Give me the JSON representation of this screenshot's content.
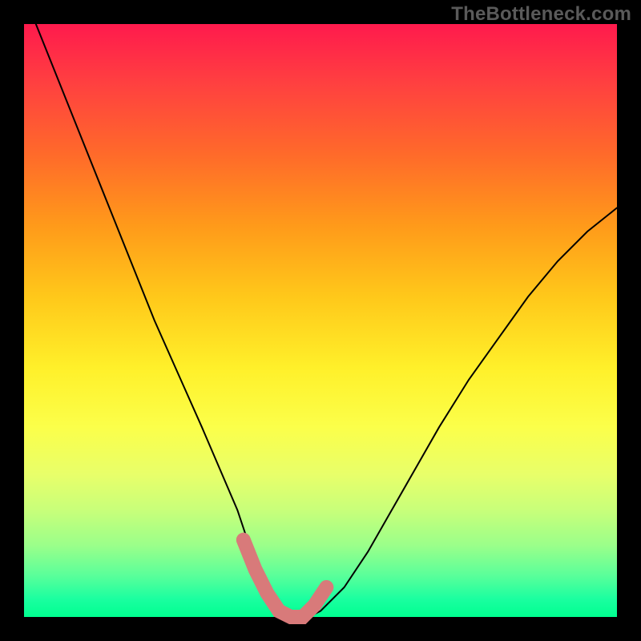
{
  "watermark": "TheBottleneck.com",
  "colors": {
    "curve_stroke": "#000000",
    "highlight_stroke": "#d87a7a",
    "frame_bg": "#000000"
  },
  "chart_data": {
    "type": "line",
    "title": "",
    "xlabel": "",
    "ylabel": "",
    "xlim": [
      0,
      100
    ],
    "ylim": [
      0,
      100
    ],
    "grid": false,
    "legend": false,
    "annotations": [
      "TheBottleneck.com"
    ],
    "description": "Single V-shaped curve on a vertical rainbow (red→green) gradient background with no axes or tick labels. A short pink segment overlays the bottom of the V. Values are estimated from the plot area.",
    "series": [
      {
        "name": "bottleneck-curve",
        "x": [
          2,
          6,
          10,
          14,
          18,
          22,
          26,
          30,
          33,
          36,
          38,
          40,
          42,
          44,
          46,
          48,
          50,
          54,
          58,
          62,
          66,
          70,
          75,
          80,
          85,
          90,
          95,
          100
        ],
        "y": [
          100,
          90,
          80,
          70,
          60,
          50,
          41,
          32,
          25,
          18,
          12,
          7,
          3,
          1,
          0,
          0,
          1,
          5,
          11,
          18,
          25,
          32,
          40,
          47,
          54,
          60,
          65,
          69
        ]
      },
      {
        "name": "floor-highlight",
        "x": [
          37,
          39,
          41,
          43,
          45,
          47,
          49,
          51
        ],
        "y": [
          13,
          8,
          4,
          1,
          0,
          0,
          2,
          5
        ]
      }
    ]
  }
}
